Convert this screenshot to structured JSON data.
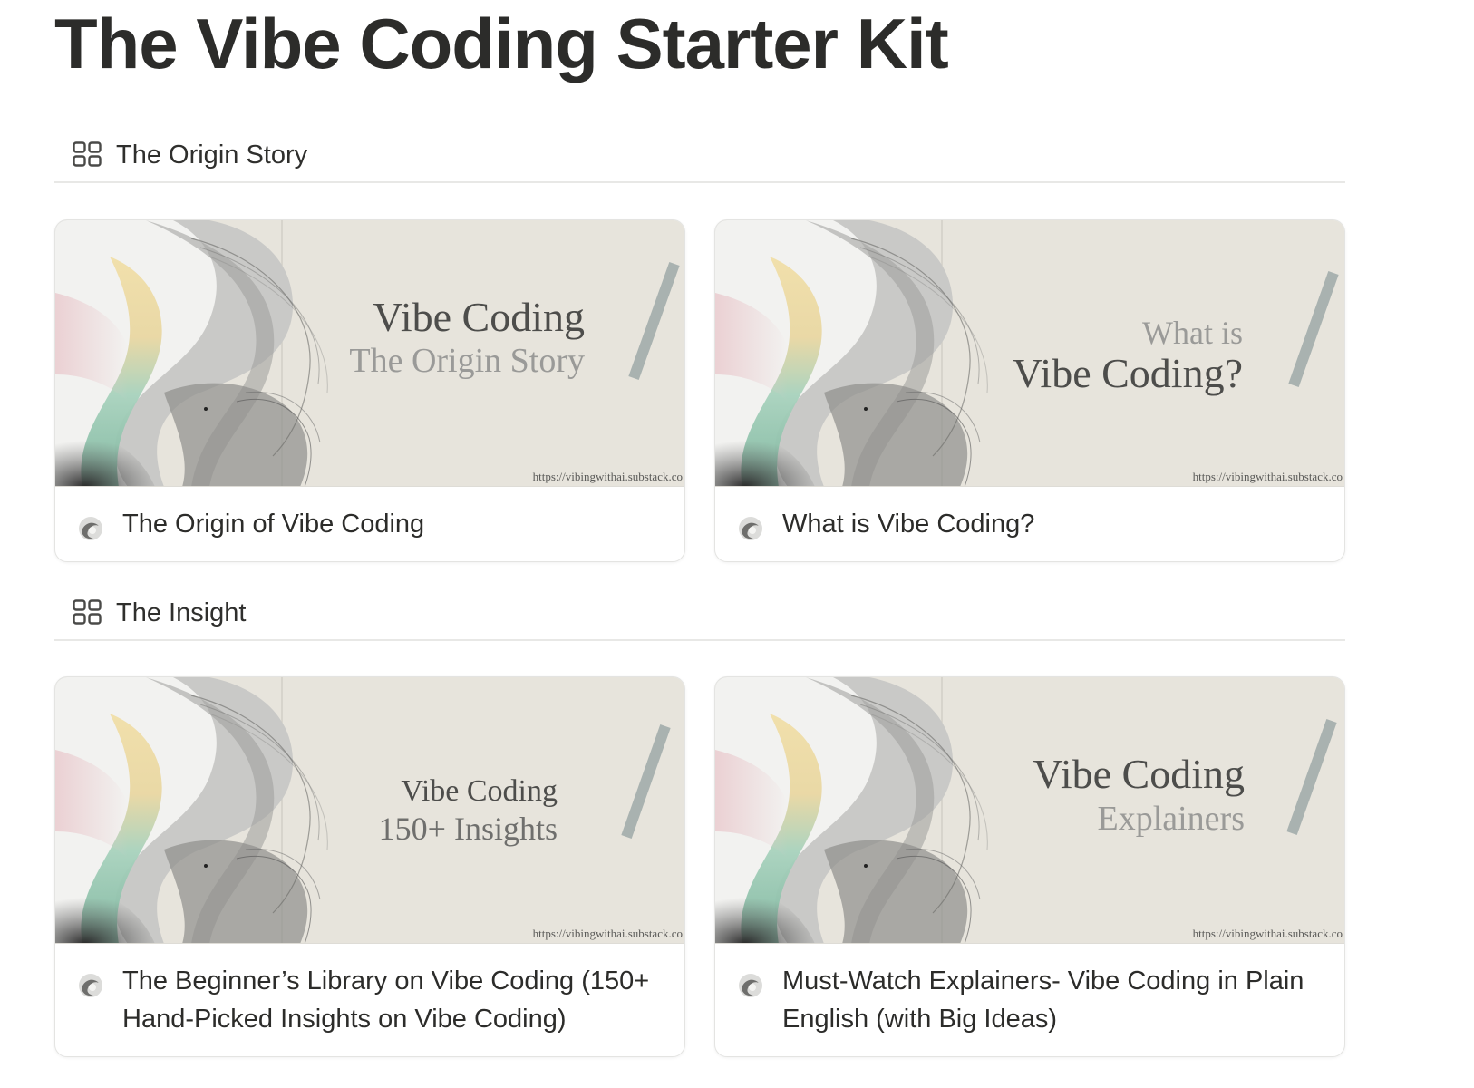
{
  "page": {
    "title": "The Vibe Coding Starter Kit"
  },
  "sections": [
    {
      "label": "The Origin Story",
      "icon": "gallery-grid-icon",
      "cards": [
        {
          "cover_line1": "Vibe Coding",
          "cover_line2": "The Origin Story",
          "cover_url": "https://vibingwithai.substack.co",
          "title": "The Origin of Vibe Coding",
          "icon": "page-thumbnail-icon"
        },
        {
          "cover_line1": "What is",
          "cover_line2": "Vibe Coding?",
          "cover_url": "https://vibingwithai.substack.co",
          "title": "What is Vibe Coding?",
          "icon": "page-thumbnail-icon"
        }
      ]
    },
    {
      "label": "The Insight",
      "icon": "gallery-grid-icon",
      "cards": [
        {
          "cover_line1": "Vibe Coding",
          "cover_line2": "150+ Insights",
          "cover_url": "https://vibingwithai.substack.co",
          "title": "The Beginner’s Library on Vibe Coding (150+ Hand-Picked Insights on Vibe Coding)",
          "icon": "page-thumbnail-icon"
        },
        {
          "cover_line1": "Vibe Coding",
          "cover_line2": "Explainers",
          "cover_url": "https://vibingwithai.substack.co",
          "title": "Must-Watch Explainers- Vibe Coding in Plain English (with Big Ideas)",
          "icon": "page-thumbnail-icon"
        }
      ]
    }
  ],
  "colors": {
    "cover_background": "#e7e4dc",
    "slash_accent": "#a9b2b0",
    "title_text": "#2c2c2a"
  }
}
